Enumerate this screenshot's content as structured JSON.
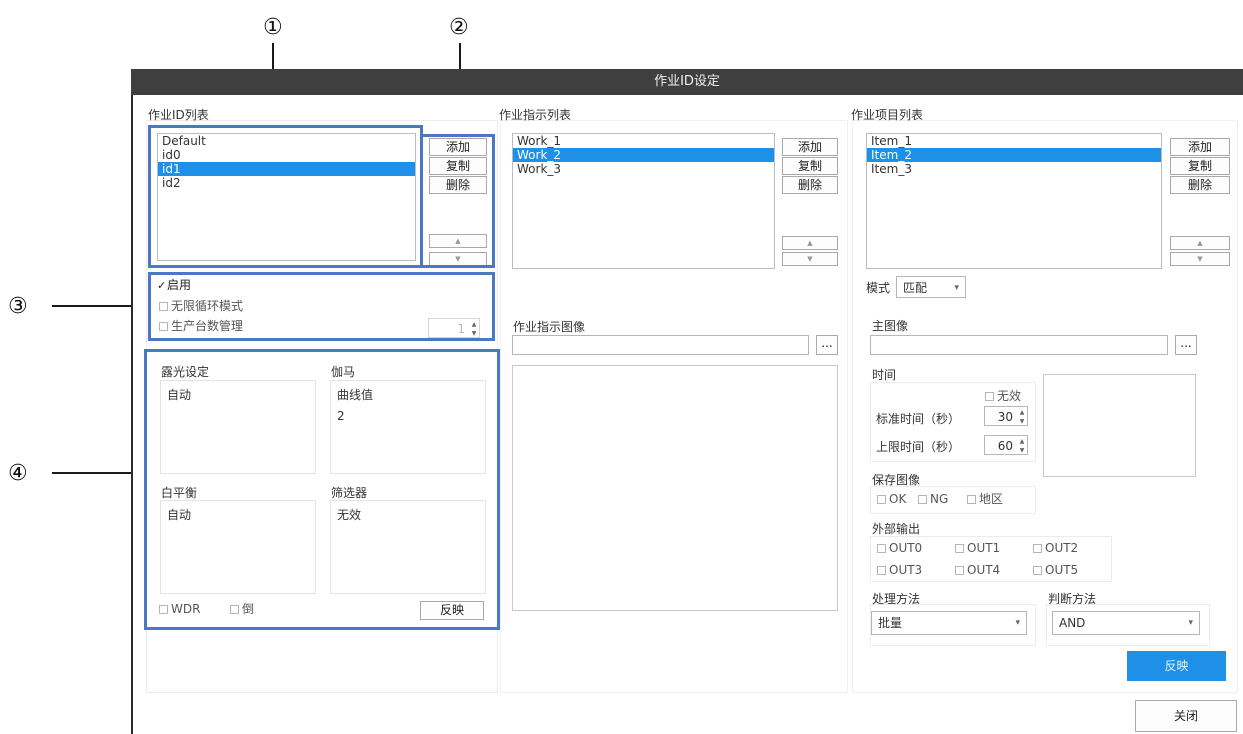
{
  "callouts": {
    "c1": "①",
    "c2": "②",
    "c3": "③",
    "c4": "④"
  },
  "title": "作业ID设定",
  "id_section": {
    "label": "作业ID列表",
    "items": [
      "Default",
      "id0",
      "id1",
      "id2"
    ],
    "selected_index": 2,
    "add": "添加",
    "copy": "复制",
    "delete": "删除",
    "up_icon": "arrow-up-icon",
    "down_icon": "arrow-down-icon",
    "enable": "启用",
    "enable_checked": true,
    "infinite_loop": "无限循环模式",
    "production_count": "生产台数管理",
    "production_value": "1"
  },
  "camera": {
    "exposure_label": "露光设定",
    "exposure_value": "自动",
    "gamma_label": "伽马",
    "gamma_curve_label": "曲线值",
    "gamma_value": "2",
    "wb_label": "白平衡",
    "wb_value": "自动",
    "filter_label": "筛选器",
    "filter_value": "无效",
    "wdr": "WDR",
    "invert": "倒",
    "apply": "反映"
  },
  "instruction": {
    "label": "作业指示列表",
    "items": [
      "Work_1",
      "Work_2",
      "Work_3"
    ],
    "selected_index": 1,
    "add": "添加",
    "copy": "复制",
    "delete": "删除",
    "image_label": "作业指示图像",
    "browse": "..."
  },
  "item": {
    "label": "作业项目列表",
    "items": [
      "Item_1",
      "Item_2",
      "Item_3"
    ],
    "selected_index": 1,
    "add": "添加",
    "copy": "复制",
    "delete": "删除",
    "mode_label": "模式",
    "mode_value": "匹配",
    "main_image_label": "主图像",
    "browse": "...",
    "time_label": "时间",
    "invalid": "无效",
    "std_time_label": "标准时间（秒）",
    "std_time_value": "30",
    "max_time_label": "上限时间（秒）",
    "max_time_value": "60",
    "save_image_label": "保存图像",
    "save_ok": "OK",
    "save_ng": "NG",
    "save_area": "地区",
    "ext_output_label": "外部输出",
    "outputs": [
      "OUT0",
      "OUT1",
      "OUT2",
      "OUT3",
      "OUT4",
      "OUT5"
    ],
    "process_label": "处理方法",
    "process_value": "批量",
    "judge_label": "判断方法",
    "judge_value": "AND",
    "apply": "反映"
  },
  "close": "关闭",
  "colors": {
    "accent": "#1e90e8",
    "callout_outline": "#4a78c2",
    "titlebar": "#3f3f3f"
  }
}
